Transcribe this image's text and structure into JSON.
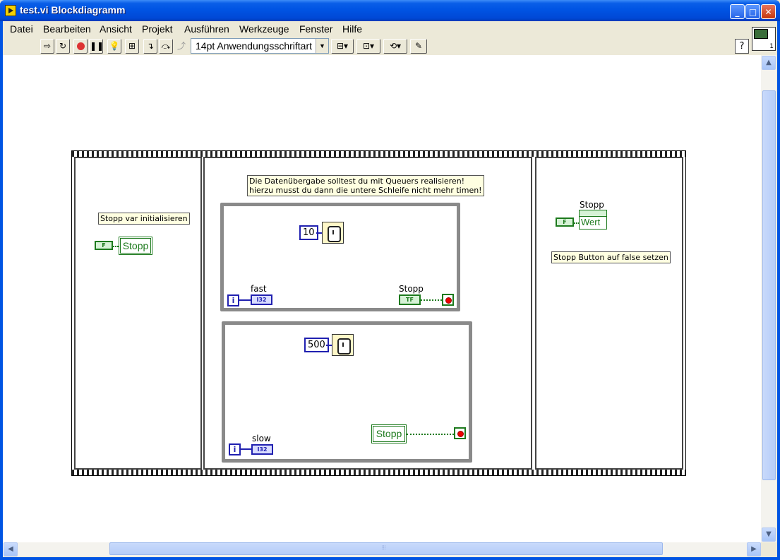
{
  "window": {
    "title": "test.vi Blockdiagramm"
  },
  "window_buttons": {
    "minimize": "_",
    "maximize": "□",
    "close": "✕"
  },
  "menu": {
    "items": [
      "Datei",
      "Bearbeiten",
      "Ansicht",
      "Projekt",
      "Ausführen",
      "Werkzeuge",
      "Fenster",
      "Hilfe"
    ]
  },
  "toolbar": {
    "font": "14pt Anwendungsschriftart",
    "help": "?",
    "icons": [
      "run-arrow-icon",
      "run-continuously-icon",
      "abort-icon",
      "pause-icon",
      "highlight-execution-icon",
      "retain-wire-values-icon",
      "step-into-icon",
      "step-over-icon",
      "step-out-icon",
      "align-objects-icon",
      "distribute-objects-icon",
      "reorder-icon",
      "cleanup-diagram-icon"
    ]
  },
  "diagram": {
    "frame1": {
      "comment": "Stopp var initialisieren",
      "bool_const": "F",
      "local_var": "Stopp"
    },
    "frame2": {
      "comment_line1": "Die Datenübergabe solltest du mit Queuers realisieren!",
      "comment_line2": "hierzu musst du dann die untere Schleife nicht mehr timen!",
      "loop1": {
        "wait_ms": "10",
        "iter": "i",
        "indicator_label": "fast",
        "indicator_type": "I32",
        "stop_label": "Stopp",
        "stop_type": "TF"
      },
      "loop2": {
        "wait_ms": "500",
        "iter": "i",
        "indicator_label": "slow",
        "indicator_type": "I32",
        "local_var": "Stopp"
      }
    },
    "frame3": {
      "prop_label": "Stopp",
      "prop_value": "Wert",
      "bool_const": "F",
      "comment": "Stopp Button auf false setzen"
    }
  },
  "scrollbars": {
    "up": "▲",
    "down": "▼",
    "left": "◀",
    "right": "▶",
    "grip": "⦙⦙⦙"
  }
}
